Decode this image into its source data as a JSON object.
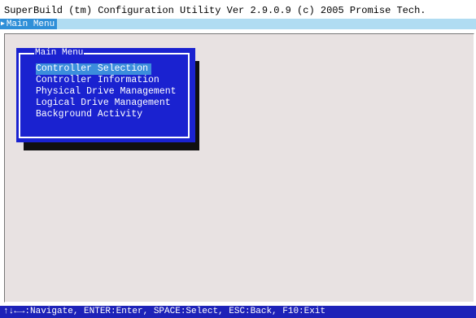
{
  "title": "SuperBuild (tm) Configuration Utility Ver 2.9.0.9 (c) 2005 Promise Tech.",
  "breadcrumb": {
    "icon": "right-triangle-icon",
    "label": "Main Menu"
  },
  "menu": {
    "title": "Main Menu",
    "selected_index": 0,
    "items": [
      {
        "label": "Controller Selection"
      },
      {
        "label": "Controller Information"
      },
      {
        "label": "Physical Drive Management"
      },
      {
        "label": "Logical Drive Management"
      },
      {
        "label": "Background Activity"
      }
    ]
  },
  "status": {
    "help_text": "↑↓←→:Navigate, ENTER:Enter, SPACE:Select, ESC:Back, F10:Exit"
  },
  "colors": {
    "menu_bg": "#1a22d0",
    "selection": "#3c8edc",
    "status_bar": "#1d22b8",
    "breadcrumb": "#2f8fd8",
    "panel": "#e8e2e2"
  }
}
